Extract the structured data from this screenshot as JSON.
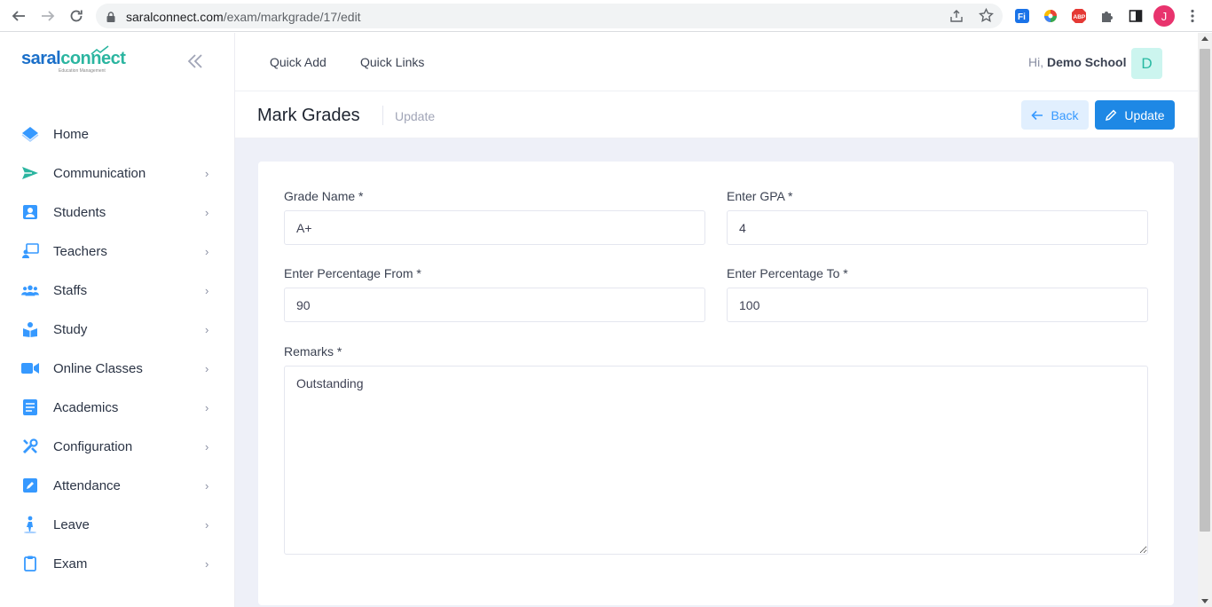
{
  "browser": {
    "url_host": "saralconnect.com",
    "url_path": "/exam/markgrade/17/edit",
    "profile_initial": "J"
  },
  "sidebar": {
    "logo_part1": "saral",
    "logo_part2": "connect",
    "logo_tagline": "Education Management",
    "items": [
      {
        "label": "Home",
        "icon": "home-icon",
        "has_submenu": false
      },
      {
        "label": "Communication",
        "icon": "paper-plane-icon",
        "has_submenu": true
      },
      {
        "label": "Students",
        "icon": "student-icon",
        "has_submenu": true
      },
      {
        "label": "Teachers",
        "icon": "teacher-icon",
        "has_submenu": true
      },
      {
        "label": "Staffs",
        "icon": "users-icon",
        "has_submenu": true
      },
      {
        "label": "Study",
        "icon": "book-reader-icon",
        "has_submenu": true
      },
      {
        "label": "Online Classes",
        "icon": "video-icon",
        "has_submenu": true
      },
      {
        "label": "Academics",
        "icon": "book-icon",
        "has_submenu": true
      },
      {
        "label": "Configuration",
        "icon": "tools-icon",
        "has_submenu": true
      },
      {
        "label": "Attendance",
        "icon": "pencil-square-icon",
        "has_submenu": true
      },
      {
        "label": "Leave",
        "icon": "person-walking-icon",
        "has_submenu": true
      },
      {
        "label": "Exam",
        "icon": "clipboard-icon",
        "has_submenu": true
      }
    ]
  },
  "header": {
    "quick_add": "Quick Add",
    "quick_links": "Quick Links",
    "greeting": "Hi,",
    "user_name": "Demo School",
    "avatar_initial": "D"
  },
  "subheader": {
    "title": "Mark Grades",
    "breadcrumb": "Update",
    "back_label": "Back",
    "update_label": "Update"
  },
  "form": {
    "grade_name_label": "Grade Name *",
    "grade_name_value": "A+",
    "gpa_label": "Enter GPA *",
    "gpa_value": "4",
    "pct_from_label": "Enter Percentage From *",
    "pct_from_value": "90",
    "pct_to_label": "Enter Percentage To *",
    "pct_to_value": "100",
    "remarks_label": "Remarks *",
    "remarks_value": "Outstanding"
  },
  "colors": {
    "primary": "#1e88e5",
    "accent_teal": "#2bb5a0",
    "page_bg": "#eef0f8"
  }
}
